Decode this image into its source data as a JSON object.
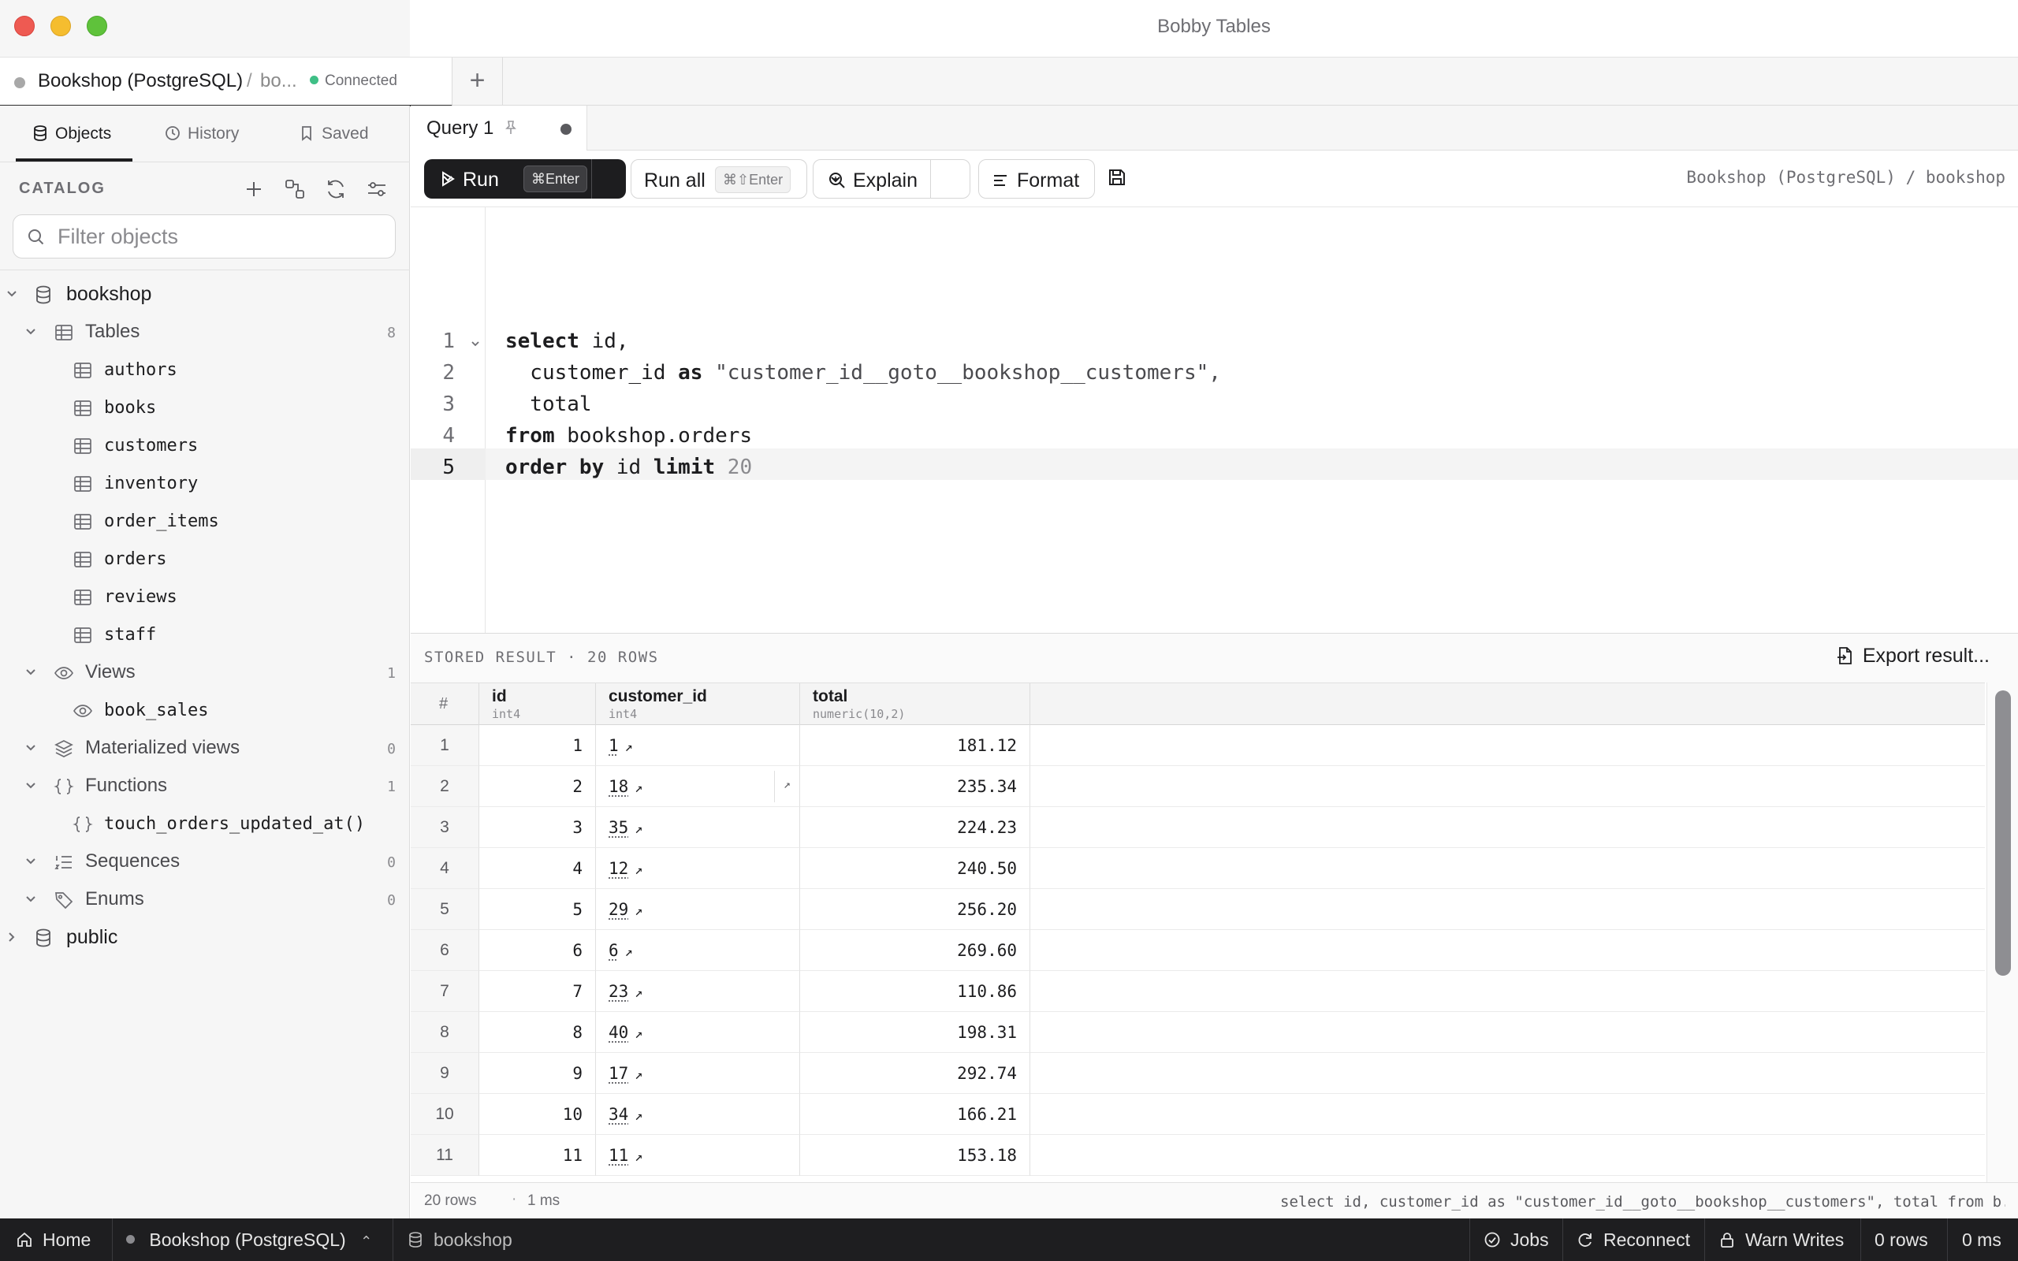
{
  "window": {
    "title": "Bobby Tables"
  },
  "connection_tab": {
    "name": "Bookshop (PostgreSQL)",
    "separator": "/",
    "database_truncated": "bo...",
    "status": "Connected",
    "add_tab_symbol": "+"
  },
  "sidebar": {
    "tabs": [
      {
        "label": "Objects",
        "icon": "database-icon",
        "active": true
      },
      {
        "label": "History",
        "icon": "clock-icon",
        "active": false
      },
      {
        "label": "Saved",
        "icon": "bookmark-icon",
        "active": false
      }
    ],
    "catalog_label": "CATALOG",
    "catalog_actions": [
      "add-icon",
      "diagram-icon",
      "refresh-icon",
      "settings-sliders-icon"
    ],
    "filter_placeholder": "Filter objects",
    "tree": {
      "bookshop": "bookshop",
      "tables": {
        "label": "Tables",
        "count": "8"
      },
      "table_items": [
        "authors",
        "books",
        "customers",
        "inventory",
        "order_items",
        "orders",
        "reviews",
        "staff"
      ],
      "views": {
        "label": "Views",
        "count": "1"
      },
      "view_items": [
        "book_sales"
      ],
      "materialized_views": {
        "label": "Materialized views",
        "count": "0"
      },
      "functions": {
        "label": "Functions",
        "count": "1"
      },
      "function_items": [
        "touch_orders_updated_at()"
      ],
      "sequences": {
        "label": "Sequences",
        "count": "0"
      },
      "enums": {
        "label": "Enums",
        "count": "0"
      },
      "public": "public"
    }
  },
  "query_tab": {
    "label": "Query 1",
    "pinned_icon": "pin-icon",
    "unsaved": true
  },
  "toolbar": {
    "run_label": "Run",
    "run_shortcut": "⌘Enter",
    "run_all_label": "Run all",
    "run_all_shortcut": "⌘⇧Enter",
    "explain_label": "Explain",
    "format_label": "Format",
    "path": "Bookshop (PostgreSQL) / bookshop"
  },
  "editor": {
    "line_numbers": [
      "1",
      "2",
      "3",
      "4",
      "5"
    ],
    "active_line": 5,
    "lines": [
      [
        {
          "t": "select",
          "k": "kw"
        },
        {
          "t": " id,",
          "k": ""
        }
      ],
      [
        {
          "t": "  customer_id ",
          "k": ""
        },
        {
          "t": "as",
          "k": "kw"
        },
        {
          "t": " \"customer_id__goto__bookshop__customers\",",
          "k": "str"
        }
      ],
      [
        {
          "t": "  total",
          "k": ""
        }
      ],
      [
        {
          "t": "from",
          "k": "kw"
        },
        {
          "t": " bookshop.orders",
          "k": ""
        }
      ],
      [
        {
          "t": "order by",
          "k": "kw"
        },
        {
          "t": " id ",
          "k": ""
        },
        {
          "t": "limit",
          "k": "kw"
        },
        {
          "t": " 20",
          "k": "num"
        }
      ]
    ]
  },
  "results": {
    "label": "STORED RESULT · 20 ROWS",
    "export_label": "Export result...",
    "columns": [
      {
        "name": "#",
        "type": ""
      },
      {
        "name": "id",
        "type": "int4"
      },
      {
        "name": "customer_id",
        "type": "int4"
      },
      {
        "name": "total",
        "type": "numeric(10,2)"
      }
    ],
    "rows": [
      [
        "1",
        "1",
        "1",
        "181.12"
      ],
      [
        "2",
        "2",
        "18",
        "235.34"
      ],
      [
        "3",
        "3",
        "35",
        "224.23"
      ],
      [
        "4",
        "4",
        "12",
        "240.50"
      ],
      [
        "5",
        "5",
        "29",
        "256.20"
      ],
      [
        "6",
        "6",
        "6",
        "269.60"
      ],
      [
        "7",
        "7",
        "23",
        "110.86"
      ],
      [
        "8",
        "8",
        "40",
        "198.31"
      ],
      [
        "9",
        "9",
        "17",
        "292.74"
      ],
      [
        "10",
        "10",
        "34",
        "166.21"
      ],
      [
        "11",
        "11",
        "11",
        "153.18"
      ]
    ],
    "link_arrow": "↗",
    "footer": {
      "rows": "20 rows",
      "dot": "·",
      "time": "1 ms",
      "sql": "select id, customer_id as \"customer_id__goto__bookshop__customers\", total from b..."
    }
  },
  "statusbar": {
    "home": "Home",
    "connection": "Bookshop (PostgreSQL)",
    "database": "bookshop",
    "jobs": "Jobs",
    "reconnect": "Reconnect",
    "warn_writes": "Warn Writes",
    "rows": "0 rows",
    "time": "0 ms"
  },
  "colors": {
    "status_connected": "#3fbf86",
    "run_button": "#1d1d1f",
    "statusbar_bg": "#1e1e20"
  }
}
